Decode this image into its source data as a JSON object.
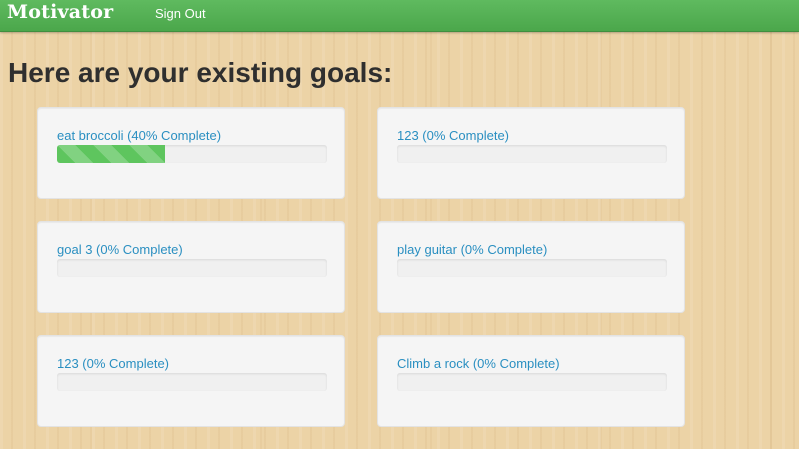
{
  "navbar": {
    "brand": "Motivator",
    "sign_out": "Sign Out",
    "color": "#53b053"
  },
  "page": {
    "heading": "Here are your existing goals:"
  },
  "goals": [
    {
      "label": "eat broccoli (40% Complete)",
      "progress_percent": 40
    },
    {
      "label": "123 (0% Complete)",
      "progress_percent": 0
    },
    {
      "label": "goal 3 (0% Complete)",
      "progress_percent": 0
    },
    {
      "label": "play guitar (0% Complete)",
      "progress_percent": 0
    },
    {
      "label": "123 (0% Complete)",
      "progress_percent": 0
    },
    {
      "label": "Climb a rock (0% Complete)",
      "progress_percent": 0
    }
  ],
  "colors": {
    "link": "#2a8fc1",
    "progress_fill": "#5ec55e",
    "heading": "#2f2f2f"
  }
}
